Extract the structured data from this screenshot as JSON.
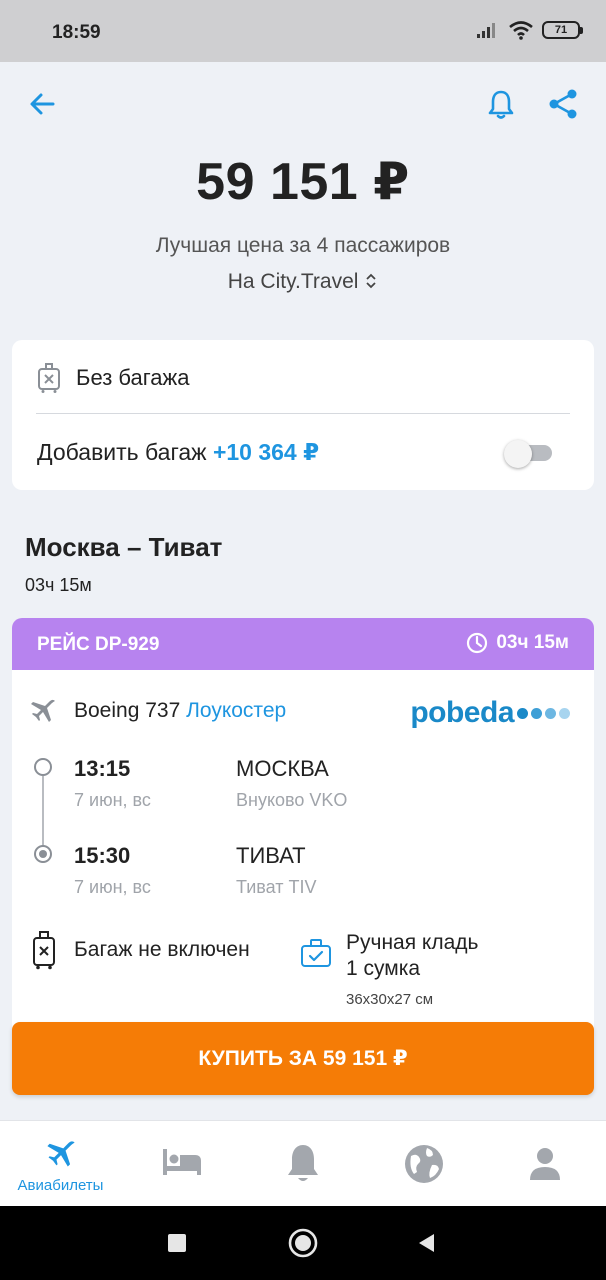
{
  "status_bar": {
    "time": "18:59",
    "battery": "71"
  },
  "header": {
    "price": "59 151 ₽",
    "subtitle": "Лучшая цена за 4 пассажиров",
    "agency": "На City.Travel"
  },
  "baggage": {
    "no_baggage_label": "Без багажа",
    "add_baggage_label": "Добавить багаж",
    "add_baggage_price": "+10 364 ₽",
    "add_baggage_enabled": false
  },
  "route": {
    "title": "Москва – Тиват",
    "duration": "03ч 15м"
  },
  "flight": {
    "number": "РЕЙС DP-929",
    "duration": "03ч 15м",
    "aircraft": "Boeing 737",
    "carrier_type": "Лоукостер",
    "airline_logo_text": "pobeda",
    "departure": {
      "time": "13:15",
      "date": "7 июн, вс",
      "city": "МОСКВА",
      "airport": "Внуково VKO"
    },
    "arrival": {
      "time": "15:30",
      "date": "7 июн, вс",
      "city": "ТИВАТ",
      "airport": "Тиват TIV"
    },
    "baggage_text": "Багаж не включен",
    "hand_luggage_line1": "Ручная кладь",
    "hand_luggage_line2": "1 сумка",
    "hand_luggage_size": "36x30x27 см"
  },
  "buy_button": "КУПИТЬ ЗА 59 151 ₽",
  "tabbar": {
    "active_label": "Авиабилеты"
  },
  "colors": {
    "accent": "#1e95e0",
    "flight_header": "#b783ef",
    "buy": "#f57c06"
  }
}
